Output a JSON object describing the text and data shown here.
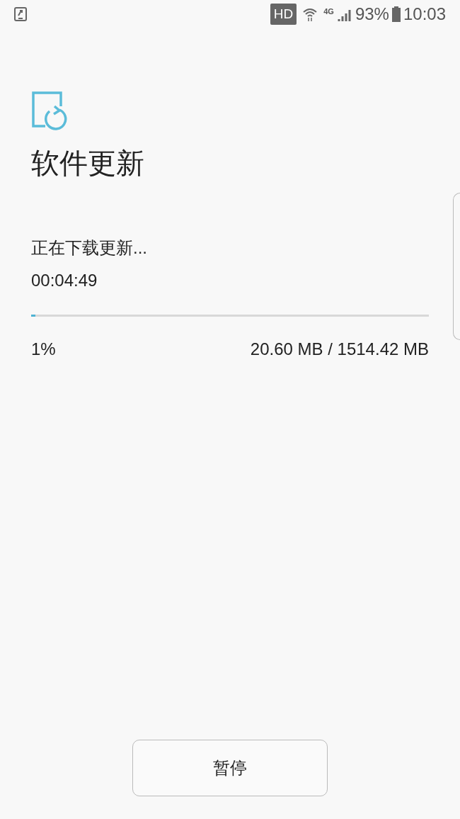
{
  "status_bar": {
    "hd": "HD",
    "network": "4G",
    "battery": "93%",
    "time": "10:03"
  },
  "title": "软件更新",
  "status": "正在下载更新...",
  "elapsed": "00:04:49",
  "progress": {
    "level": 0.01,
    "percent": "1%",
    "size": "20.60 MB / 1514.42 MB"
  },
  "buttons": [
    "暂停"
  ]
}
